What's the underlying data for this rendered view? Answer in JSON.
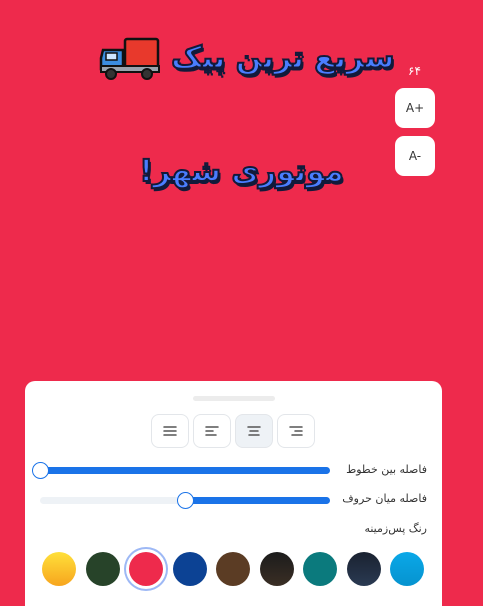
{
  "canvas": {
    "line1": "سریع ترین پیک",
    "line2": "موتوری شهر!",
    "background_color": "#ee2a4c"
  },
  "font_controls": {
    "size_value": "۶۴",
    "increase_label": "A+",
    "decrease_label": "A-"
  },
  "panel": {
    "line_spacing_label": "فاصله بین خطوط",
    "line_spacing_value": 0.0,
    "letter_spacing_label": "فاصله میان حروف",
    "letter_spacing_value": 0.5,
    "bg_color_label": "رنگ پس‌زمینه",
    "align_selected": "center",
    "swatches": [
      "#06a0de",
      "#1d2c3e",
      "#0b7a7d",
      "#2a221b",
      "#5b3c24",
      "#0c4294",
      "#ee2a4c",
      "#274329",
      "#f9b71b"
    ],
    "selected_swatch": "#ee2a4c"
  }
}
